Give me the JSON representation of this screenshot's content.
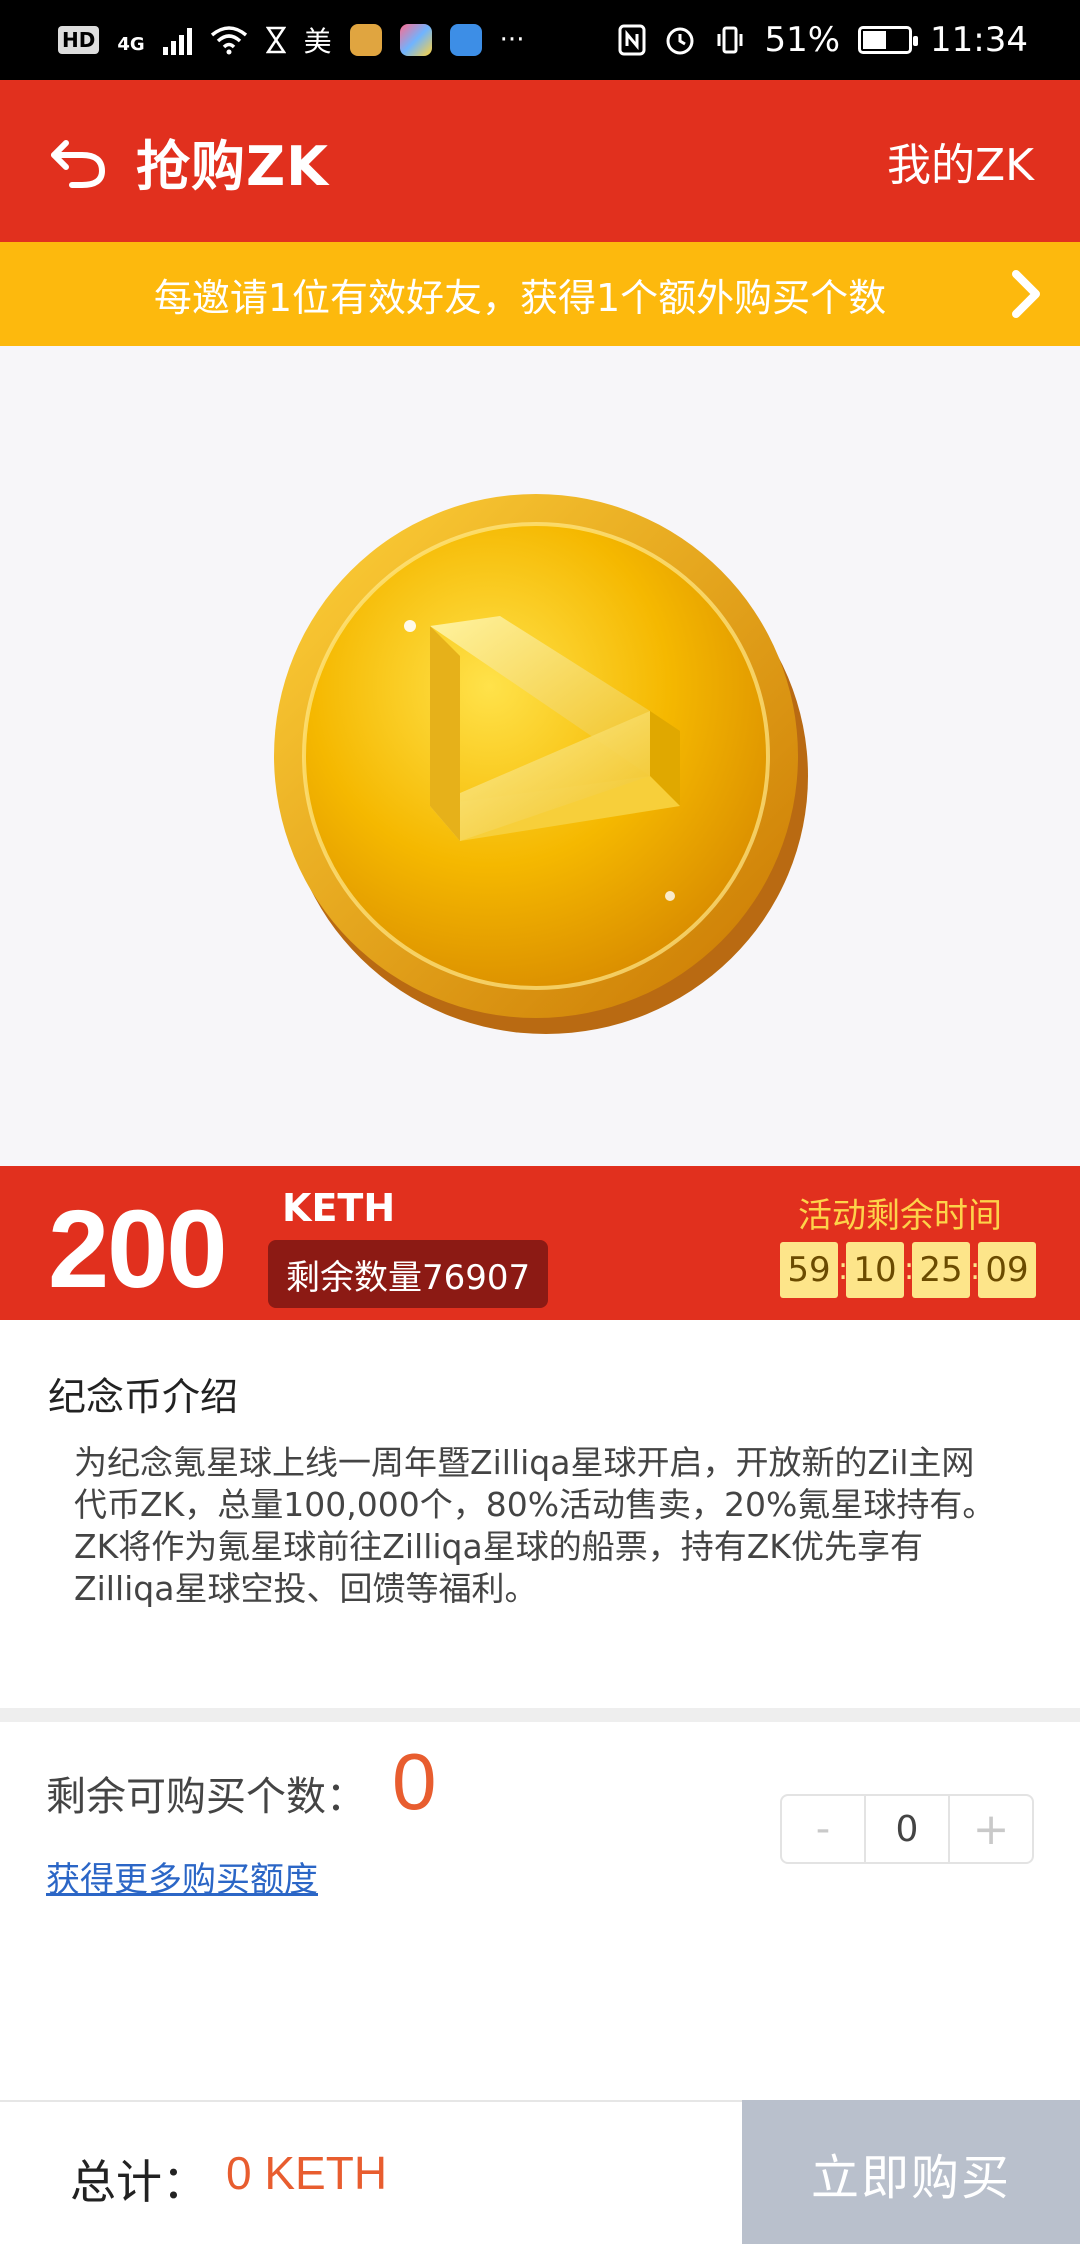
{
  "status_bar": {
    "left_chip": "HD",
    "network": "4G",
    "app_label": "美",
    "more": "···",
    "battery_percent": "51%",
    "battery_level": 0.51,
    "time": "11:34"
  },
  "header": {
    "title": "抢购ZK",
    "right_link": "我的ZK"
  },
  "banner": {
    "text": "每邀请1位有效好友，获得1个额外购买个数"
  },
  "price": {
    "amount": "200",
    "unit": "KETH",
    "remaining_stock": "剩余数量76907",
    "countdown_label": "活动剩余时间",
    "countdown": [
      "59",
      "10",
      "25",
      "09"
    ]
  },
  "intro": {
    "title": "纪念币介绍",
    "paragraph1": "为纪念氪星球上线一周年暨Zilliqa星球开启，开放新的Zil主网代币ZK，总量100,000个，80%活动售卖，20%氪星球持有。",
    "paragraph2": "ZK将作为氪星球前往Zilliqa星球的船票，持有ZK优先享有Zilliqa星球空投、回馈等福利。"
  },
  "quantity": {
    "label": "剩余可购买个数：",
    "value": "0",
    "more_link": "获得更多购买额度",
    "stepper_minus": "-",
    "stepper_value": "0",
    "stepper_plus": "+"
  },
  "footer": {
    "total_label": "总计：",
    "total_value": "0 KETH",
    "buy_button": "立即购买"
  },
  "colors": {
    "brand_red": "#e1301e",
    "banner_yellow": "#fdb90d",
    "accent_orange": "#e85d2f",
    "link_blue": "#2b66c6",
    "disabled_button": "#b9c0cc"
  },
  "icons": [
    "back-arrow-icon",
    "chevron-right-icon",
    "zk-coin-logo",
    "wifi-icon",
    "signal-icon",
    "nfc-icon",
    "alarm-icon",
    "vibrate-icon",
    "battery-icon"
  ]
}
